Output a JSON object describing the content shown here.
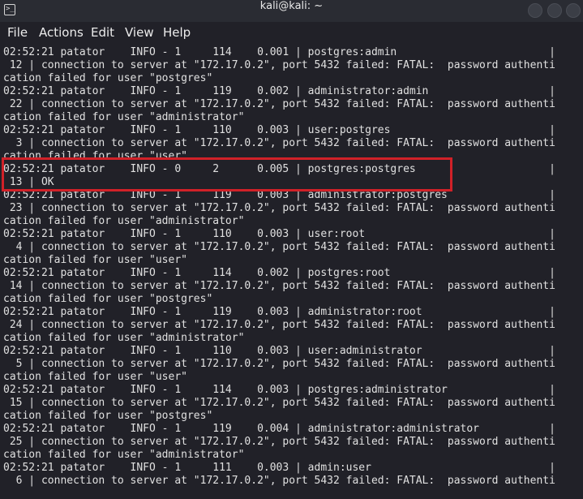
{
  "window": {
    "title": "kali@kali: ~",
    "terminal_icon": "terminal-icon",
    "controls": [
      "minimize-button",
      "maximize-button",
      "close-button"
    ]
  },
  "menubar": {
    "items": [
      "File",
      "Actions",
      "Edit",
      "View",
      "Help"
    ]
  },
  "colors": {
    "background": "#212128",
    "text": "#e0e0e0",
    "highlight_border": "#d12128"
  },
  "terminal": {
    "lines": [
      "02:52:21 patator    INFO - 1     114    0.001 | postgres:admin                        |",
      " 12 | connection to server at \"172.17.0.2\", port 5432 failed: FATAL:  password authenti",
      "cation failed for user \"postgres\"",
      "02:52:21 patator    INFO - 1     119    0.002 | administrator:admin                   |",
      " 22 | connection to server at \"172.17.0.2\", port 5432 failed: FATAL:  password authenti",
      "cation failed for user \"administrator\"",
      "02:52:21 patator    INFO - 1     110    0.003 | user:postgres                         |",
      "  3 | connection to server at \"172.17.0.2\", port 5432 failed: FATAL:  password authenti",
      "cation failed for user \"user\"",
      "02:52:21 patator    INFO - 0     2      0.005 | postgres:postgres                     |",
      " 13 | OK",
      "02:52:21 patator    INFO - 1     119    0.003 | administrator:postgres                |",
      " 23 | connection to server at \"172.17.0.2\", port 5432 failed: FATAL:  password authenti",
      "cation failed for user \"administrator\"",
      "02:52:21 patator    INFO - 1     110    0.003 | user:root                             |",
      "  4 | connection to server at \"172.17.0.2\", port 5432 failed: FATAL:  password authenti",
      "cation failed for user \"user\"",
      "02:52:21 patator    INFO - 1     114    0.002 | postgres:root                         |",
      " 14 | connection to server at \"172.17.0.2\", port 5432 failed: FATAL:  password authenti",
      "cation failed for user \"postgres\"",
      "02:52:21 patator    INFO - 1     119    0.003 | administrator:root                    |",
      " 24 | connection to server at \"172.17.0.2\", port 5432 failed: FATAL:  password authenti",
      "cation failed for user \"administrator\"",
      "02:52:21 patator    INFO - 1     110    0.003 | user:administrator                    |",
      "  5 | connection to server at \"172.17.0.2\", port 5432 failed: FATAL:  password authenti",
      "cation failed for user \"user\"",
      "02:52:21 patator    INFO - 1     114    0.003 | postgres:administrator                |",
      " 15 | connection to server at \"172.17.0.2\", port 5432 failed: FATAL:  password authenti",
      "cation failed for user \"postgres\"",
      "02:52:21 patator    INFO - 1     119    0.004 | administrator:administrator           |",
      " 25 | connection to server at \"172.17.0.2\", port 5432 failed: FATAL:  password authenti",
      "cation failed for user \"administrator\"",
      "02:52:21 patator    INFO - 1     111    0.003 | admin:user                            |",
      "  6 | connection to server at \"172.17.0.2\", port 5432 failed: FATAL:  password authenti"
    ]
  }
}
